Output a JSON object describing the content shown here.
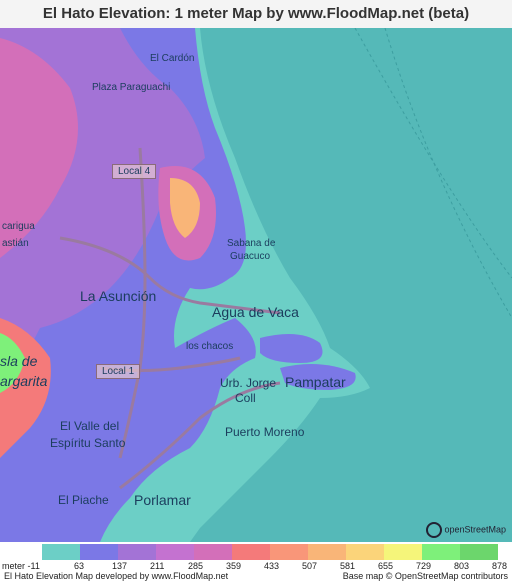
{
  "title": "El Hato Elevation: 1 meter Map by www.FloodMap.net (beta)",
  "map": {
    "labels": {
      "el_cardon": "El Cardón",
      "plaza_paraguachi": "Plaza Paraguachi",
      "local4": "Local 4",
      "local1": "Local 1",
      "carigua": "carigua",
      "astian": "astián",
      "sabana": "Sabana de",
      "guacuco": "Guacuco",
      "la_asuncion": "La Asunción",
      "agua_de_vaca": "Agua de Vaca",
      "los_chacos": "los chacos",
      "isla_de": "sla de",
      "margarita": "argarita",
      "urb_jorge": "Urb. Jorge",
      "coll": "Coll",
      "pampatar": "Pampatar",
      "el_valle": "El Valle del",
      "espiritu_santo": "Espíritu Santo",
      "puerto_moreno": "Puerto Moreno",
      "el_piache": "El Piache",
      "porlamar": "Porlamar"
    },
    "osm_logo": "openStreetMap"
  },
  "legend": {
    "colors": [
      "#6ccfc6",
      "#7b78e6",
      "#a373d6",
      "#c472d0",
      "#d36fb9",
      "#f47a7a",
      "#f99679",
      "#f9b578",
      "#fbd47a",
      "#f5f57a",
      "#7ef07a",
      "#6cd66c"
    ],
    "ticks": [
      "meter -11",
      "63",
      "137",
      "211",
      "285",
      "359",
      "433",
      "507",
      "581",
      "655",
      "729",
      "803",
      "878"
    ]
  },
  "credits": {
    "left": "El Hato Elevation Map developed by www.FloodMap.net",
    "right": "Base map © OpenStreetMap contributors"
  }
}
